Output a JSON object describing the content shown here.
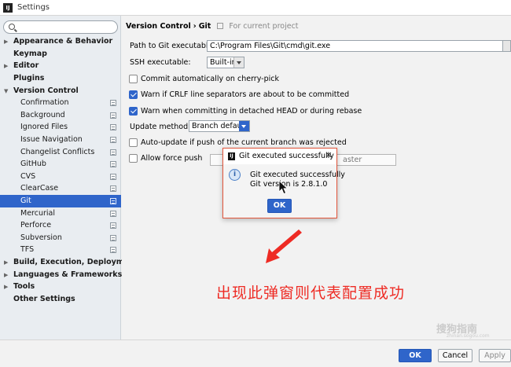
{
  "window": {
    "title": "Settings"
  },
  "search": {
    "placeholder": ""
  },
  "sidebar": {
    "items": [
      {
        "label": "Appearance & Behavior",
        "arrow": "▶"
      },
      {
        "label": "Keymap",
        "arrow": ""
      },
      {
        "label": "Editor",
        "arrow": "▶"
      },
      {
        "label": "Plugins",
        "arrow": ""
      },
      {
        "label": "Version Control",
        "arrow": "▼"
      },
      {
        "label": "Confirmation"
      },
      {
        "label": "Background"
      },
      {
        "label": "Ignored Files"
      },
      {
        "label": "Issue Navigation"
      },
      {
        "label": "Changelist Conflicts"
      },
      {
        "label": "GitHub"
      },
      {
        "label": "CVS"
      },
      {
        "label": "ClearCase"
      },
      {
        "label": "Git"
      },
      {
        "label": "Mercurial"
      },
      {
        "label": "Perforce"
      },
      {
        "label": "Subversion"
      },
      {
        "label": "TFS"
      },
      {
        "label": "Build, Execution, Deployment",
        "arrow": "▶"
      },
      {
        "label": "Languages & Frameworks",
        "arrow": "▶"
      },
      {
        "label": "Tools",
        "arrow": "▶"
      },
      {
        "label": "Other Settings",
        "arrow": ""
      }
    ]
  },
  "breadcrumb": {
    "section": "Version Control",
    "separator": "›",
    "page": "Git",
    "scope": "For current project"
  },
  "git": {
    "path_label": "Path to Git executable:",
    "path_value": "C:\\Program Files\\Git\\cmd\\git.exe",
    "ssh_label": "SSH executable:",
    "ssh_value": "Built-in",
    "commit_cherry_pick": "Commit automatically on cherry-pick",
    "warn_crlf": "Warn if CRLF line separators are about to be committed",
    "warn_detached": "Warn when committing in detached HEAD or during rebase",
    "update_method_label": "Update method:",
    "update_method_value": "Branch default",
    "auto_update": "Auto-update if push of the current branch was rejected",
    "allow_force_push": "Allow force push",
    "protected_branches_visible": "aster"
  },
  "dialog": {
    "title": "Git executed successfully",
    "line1": "Git executed successfully",
    "line2": "Git version is 2.8.1.0",
    "ok": "OK"
  },
  "buttons": {
    "ok": "OK",
    "cancel": "Cancel",
    "apply": "Apply"
  },
  "annotation": {
    "text": "出现此弹窗则代表配置成功",
    "color": "#ee2b24"
  },
  "watermark": {
    "text": "搜狗指南",
    "url": "zhinan.sogou.com"
  },
  "colors": {
    "accent": "#2f65ca",
    "dialog_border": "#e2553b"
  }
}
